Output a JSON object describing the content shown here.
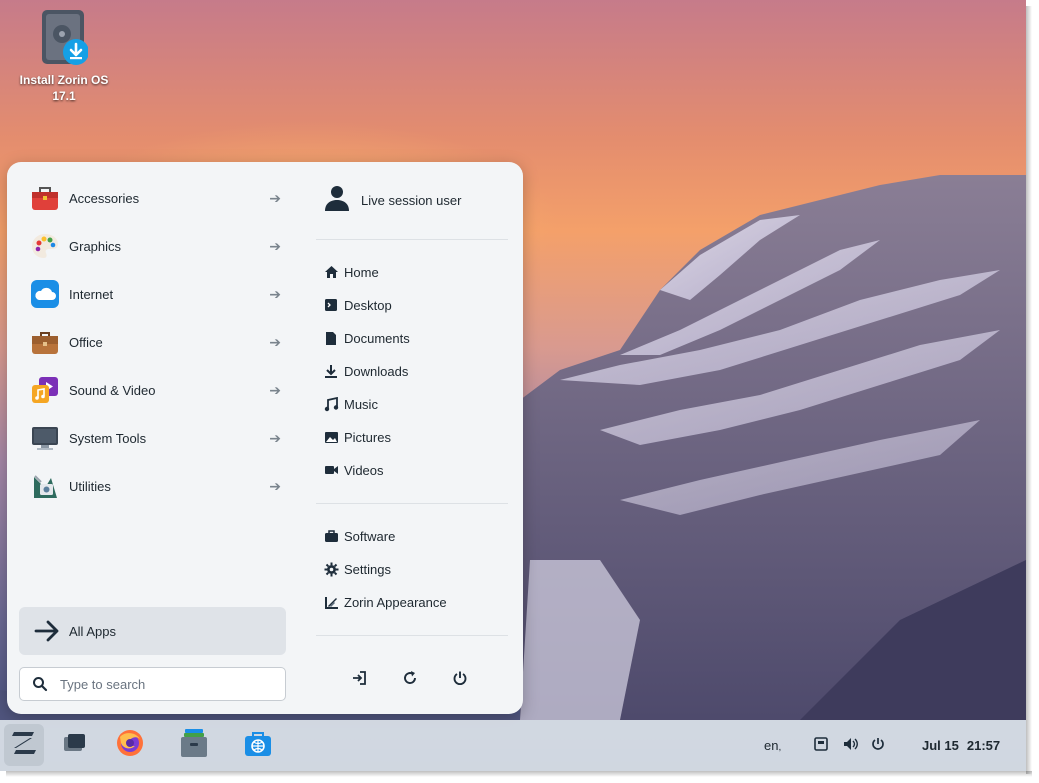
{
  "desktop": {
    "icon_label_line1": "Install Zorin OS",
    "icon_label_line2": "17.1"
  },
  "menu": {
    "categories": [
      {
        "label": "Accessories",
        "icon": "toolbox-icon"
      },
      {
        "label": "Graphics",
        "icon": "palette-icon"
      },
      {
        "label": "Internet",
        "icon": "cloud-icon"
      },
      {
        "label": "Office",
        "icon": "briefcase-icon"
      },
      {
        "label": "Sound & Video",
        "icon": "media-icon"
      },
      {
        "label": "System Tools",
        "icon": "monitor-icon"
      },
      {
        "label": "Utilities",
        "icon": "utilities-icon"
      }
    ],
    "all_apps": "All Apps",
    "search_placeholder": "Type to search",
    "user": "Live session user",
    "places": [
      {
        "label": "Home",
        "icon": "home-icon"
      },
      {
        "label": "Desktop",
        "icon": "desktop-icon"
      },
      {
        "label": "Documents",
        "icon": "document-icon"
      },
      {
        "label": "Downloads",
        "icon": "download-icon"
      },
      {
        "label": "Music",
        "icon": "music-icon"
      },
      {
        "label": "Pictures",
        "icon": "pictures-icon"
      },
      {
        "label": "Videos",
        "icon": "video-icon"
      }
    ],
    "system": [
      {
        "label": "Software",
        "icon": "software-icon"
      },
      {
        "label": "Settings",
        "icon": "gear-icon"
      },
      {
        "label": "Zorin Appearance",
        "icon": "appearance-icon"
      }
    ],
    "power_buttons": [
      "logout-icon",
      "restart-icon",
      "power-icon"
    ]
  },
  "taskbar": {
    "apps": [
      "zorin-menu-icon",
      "workspaces-icon",
      "firefox-icon",
      "files-icon",
      "software-store-icon"
    ],
    "keyboard_layout": "en",
    "date": "Jul 15",
    "time": "21:57"
  },
  "colors": {
    "accent": "#1a73e8",
    "menu_bg": "#f3f5f7",
    "icon_dark": "#1e2d3b"
  }
}
